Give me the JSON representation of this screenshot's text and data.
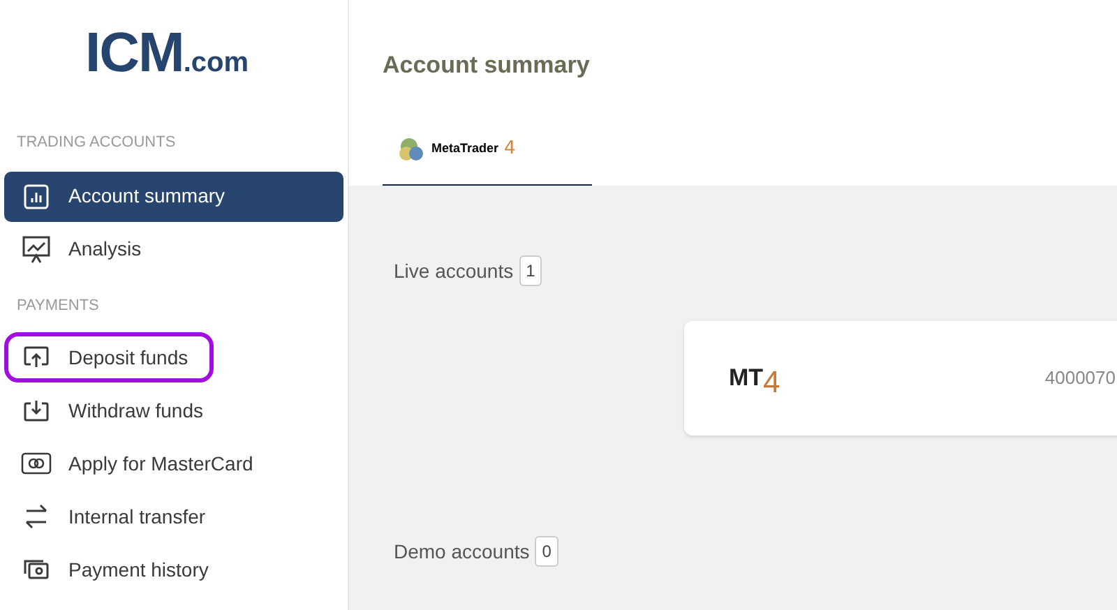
{
  "logo": {
    "name": "ICM",
    "suffix": ".com"
  },
  "sidebar": {
    "sections": [
      {
        "heading": "TRADING ACCOUNTS",
        "items": [
          {
            "label": "Account summary",
            "selected": true,
            "highlighted": false
          },
          {
            "label": "Analysis",
            "selected": false,
            "highlighted": false
          }
        ]
      },
      {
        "heading": "PAYMENTS",
        "items": [
          {
            "label": "Deposit funds",
            "selected": false,
            "highlighted": true
          },
          {
            "label": "Withdraw funds",
            "selected": false,
            "highlighted": false
          },
          {
            "label": "Apply for MasterCard",
            "selected": false,
            "highlighted": false
          },
          {
            "label": "Internal transfer",
            "selected": false,
            "highlighted": false
          },
          {
            "label": "Payment history",
            "selected": false,
            "highlighted": false
          }
        ]
      }
    ]
  },
  "page_title": "Account summary",
  "tabs": [
    {
      "name": "MetaTrader",
      "version": "4",
      "selected": true
    }
  ],
  "live_accounts": {
    "label": "Live accounts",
    "count": "1",
    "accounts": [
      {
        "platform": "MT",
        "version": "4",
        "number": "4000070"
      }
    ]
  },
  "demo_accounts": {
    "label": "Demo accounts",
    "count": "0"
  }
}
